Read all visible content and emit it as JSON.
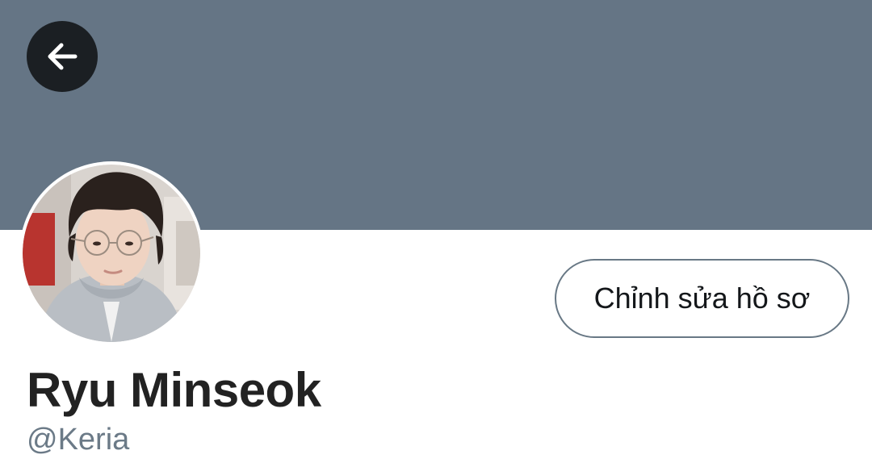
{
  "header": {
    "banner_color": "#657585",
    "back_icon": "arrow-left-icon"
  },
  "profile": {
    "avatar_alt": "profile photo",
    "display_name": "Ryu Minseok",
    "handle": "@Keria"
  },
  "actions": {
    "edit_profile_label": "Chỉnh sửa hồ sơ"
  }
}
